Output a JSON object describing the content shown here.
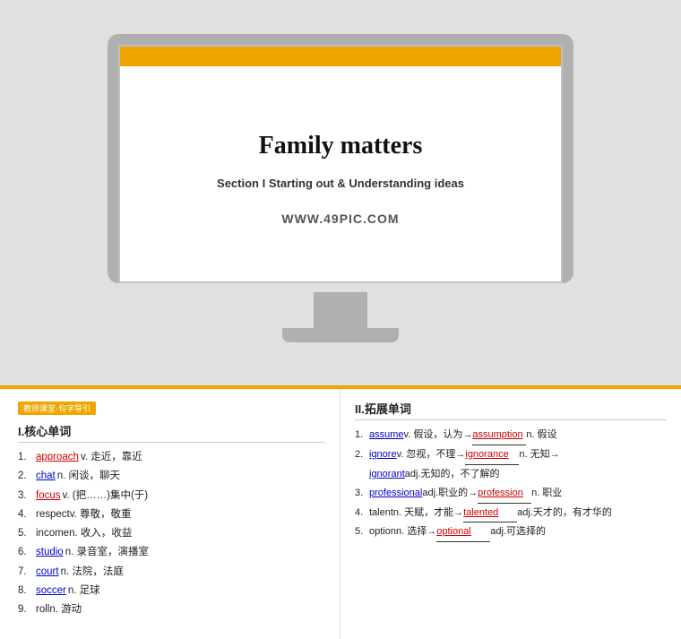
{
  "monitor": {
    "slide": {
      "title": "Family matters",
      "subtitle": "Section I Starting out & Understanding ideas",
      "watermark": "WWW.49PIC.COM"
    }
  },
  "content": {
    "left": {
      "tag": "教师课堂·句字导引",
      "section_title": "I.核心单词",
      "vocab": [
        {
          "num": "1.",
          "word": "approach",
          "type": "red",
          "def": " v. 走近，靠近"
        },
        {
          "num": "2.",
          "word": "chat",
          "type": "blue",
          "def": " n. 闲谈，聊天"
        },
        {
          "num": "3.",
          "word": "focus",
          "type": "red",
          "def": " v. (把……)集中(于)"
        },
        {
          "num": "4.",
          "word": "respect",
          "type": "none",
          "def": "v. 尊敬，敬重"
        },
        {
          "num": "5.",
          "word": "income",
          "type": "none",
          "def": " n. 收入，收益"
        },
        {
          "num": "6.",
          "word": "studio",
          "type": "blue",
          "def": "  n. 录音室，演播室"
        },
        {
          "num": "7.",
          "word": "court",
          "type": "blue",
          "def": "  n. 法院，法庭"
        },
        {
          "num": "8.",
          "word": "soccer",
          "type": "none",
          "def": "  n. 足球"
        },
        {
          "num": "9.",
          "word": "roll",
          "type": "none",
          "def": "  n. 游动"
        }
      ]
    },
    "right": {
      "section_title": "II.拓展单词",
      "expand": [
        {
          "num": "1.",
          "word1": "assume",
          "type1": "blue",
          "def1": " v. 假设，认为→",
          "blank": "assumption",
          "def2": " n. 假设"
        },
        {
          "num": "2.",
          "word1": "ignore",
          "type1": "blue",
          "def1": " v. 忽视，不理→",
          "blank": "ignorance",
          "def2": " n. 无知→",
          "word2": "ignorant",
          "type2": "blue",
          "def3": " adj.无知的，不了解的"
        },
        {
          "num": "3.",
          "word1": "professional",
          "type1": "blue",
          "def1": " adj.职业的→",
          "blank": "profession",
          "def2": " n. 职业"
        },
        {
          "num": "4.",
          "word1": "talent",
          "type1": "none",
          "def1": " n. 天赋，才能→",
          "blank": "talented",
          "blank_type": "adj",
          "def2": " adj.天才的，有才华的"
        },
        {
          "num": "5.",
          "word1": "option",
          "type1": "none",
          "def1": " n. 选择→",
          "blank": "optional",
          "blank_type": "adj",
          "def2": " adj.可选择的"
        }
      ]
    }
  }
}
